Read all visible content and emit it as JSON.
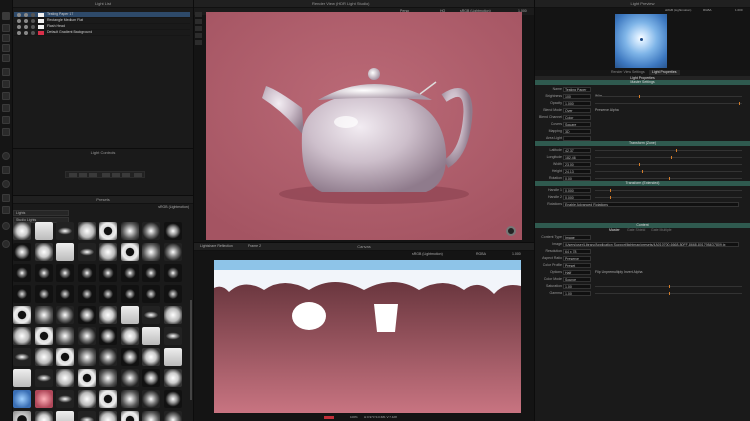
{
  "light_list": {
    "title": "Light List",
    "items": [
      {
        "label": "Testing Paper 17",
        "swatch": "#f2f2f2",
        "selected": true
      },
      {
        "label": "Rectangle Medium Flat",
        "swatch": "#f2f2f2",
        "selected": false
      },
      {
        "label": "Flash Head",
        "swatch": "#f2f2f2",
        "selected": false
      },
      {
        "label": "Default Gradient Background",
        "swatch": "#d9304a",
        "selected": false
      }
    ]
  },
  "light_controls": {
    "title": "Light Controls"
  },
  "presets": {
    "title": "Presets",
    "colorspace": "sRGB (Lightmotion)",
    "category": "Lights",
    "subcategory": "Studio Lights"
  },
  "render_view": {
    "title": "Render View (HDR Light Studio)",
    "mode": "Persp",
    "quality": "HQ",
    "colorspace": "sRGB (Lightmotion)",
    "zoom": "1.000",
    "colors": {
      "bg": "#b05f6e",
      "teapot": "#d5ccd6"
    }
  },
  "canvas": {
    "title": "Canvas",
    "tab": "Lightshare Reflection",
    "frame": "Frame 2",
    "colorspace": "sRGB (Lightmotion)",
    "channel": "RGBA",
    "zoom": "1.000",
    "status_value": "100%",
    "status_text": "H:0.973 S:0.681 V:7.428"
  },
  "light_preview": {
    "title": "Light Preview",
    "colorspace": "sRGB (Lightmotion)",
    "channel": "RGBA",
    "zoom": "1.000"
  },
  "properties": {
    "tabs": [
      "Render View Settings",
      "Light Properties"
    ],
    "active_tab": "Light Properties",
    "section_light": "Light Properties",
    "section_master": "Master Settings",
    "fields": [
      {
        "label": "Name",
        "value": "Testing Paper 17"
      },
      {
        "label": "Brightness",
        "value": "100",
        "extra": "W/m",
        "slider": 0.3
      },
      {
        "label": "Opacity",
        "value": "1.000",
        "slider": 0.98
      },
      {
        "label": "Blend Mode",
        "value": "Over",
        "extra": "Preserve Alpha"
      },
      {
        "label": "Blend Channel",
        "value": "Color"
      },
      {
        "label": "Covers",
        "value": "Square"
      },
      {
        "label": "Mapping",
        "value": "3D"
      },
      {
        "label": "Area Light",
        "value": ""
      }
    ],
    "section_transform": "Transform (Zone)",
    "transform": [
      {
        "label": "Latitude",
        "value": "42.37",
        "slider": 0.55
      },
      {
        "label": "Longitude",
        "value": "182.46",
        "slider": 0.52
      },
      {
        "label": "Width",
        "value": "23.00",
        "slider": 0.3
      },
      {
        "label": "Height",
        "value": "24.13",
        "slider": 0.32
      },
      {
        "label": "Rotation",
        "value": "0.00",
        "slider": 0.5
      }
    ],
    "section_freeform": "Transform (Extended)",
    "freeform": [
      {
        "label": "Handle 1",
        "value": "0.000",
        "slider": 0.1
      },
      {
        "label": "Handle 2",
        "value": "0.000",
        "slider": 0.1
      },
      {
        "label": "Rotations",
        "value": "Enable Advanced Rotations"
      }
    ],
    "section_content": "Content",
    "content_tabs": [
      "Master",
      "Gate Shield",
      "Gate Multiple"
    ],
    "content": [
      {
        "label": "Content Type",
        "value": "Image"
      },
      {
        "label": "Image",
        "value": "/Users/user/Library/Application Support/lightmap/presets/4A010700-6668-80FF-8668-8017984D7809.tx"
      },
      {
        "label": "Resolution",
        "value": "64 x 78"
      },
      {
        "label": "Aspect Ratio",
        "value": "Preserve"
      },
      {
        "label": "Color Profile",
        "value": "Preset"
      },
      {
        "label": "Options",
        "value": "Half",
        "extra": "Flip  Unpremultiply  Invert Alpha"
      },
      {
        "label": "Color Mode",
        "value": "Source"
      },
      {
        "label": "Saturation",
        "value": "1.00",
        "slider": 0.5
      },
      {
        "label": "Gamma",
        "value": "1.00",
        "slider": 0.5
      }
    ]
  }
}
